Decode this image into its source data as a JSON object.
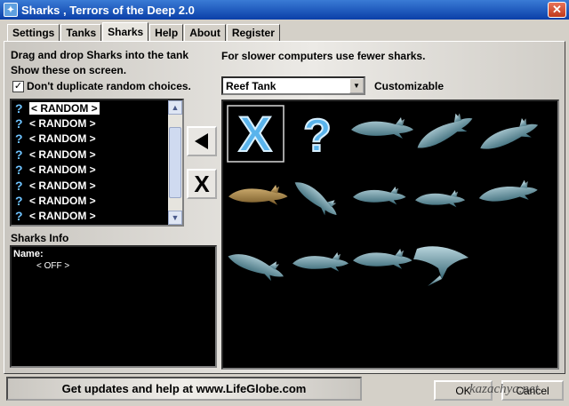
{
  "window": {
    "title": "Sharks , Terrors of the Deep 2.0"
  },
  "tabs": [
    {
      "label": "Settings"
    },
    {
      "label": "Tanks"
    },
    {
      "label": "Sharks"
    },
    {
      "label": "Help"
    },
    {
      "label": "About"
    },
    {
      "label": "Register"
    }
  ],
  "active_tab": "Sharks",
  "left": {
    "instruction1": "Drag and drop Sharks into the tank",
    "instruction2": "Show these on screen.",
    "no_duplicate_label": "Don't duplicate random choices.",
    "no_duplicate_checked": true,
    "list_items": [
      "< RANDOM >",
      "< RANDOM >",
      "< RANDOM >",
      "< RANDOM >",
      "< RANDOM >",
      "< RANDOM >",
      "< RANDOM >",
      "< RANDOM >"
    ],
    "info_heading": "Sharks Info",
    "info_name_label": "Name:",
    "info_name_value": "< OFF >"
  },
  "right": {
    "hint": "For slower computers use fewer sharks.",
    "tank_select_value": "Reef Tank",
    "customizable_label": "Customizable"
  },
  "icons": [
    "app-icon",
    "close-icon",
    "question-icon",
    "arrow-left-icon",
    "remove-x-icon",
    "off-x-icon",
    "random-question-icon",
    "shark-icon",
    "manta-ray-icon",
    "check-icon",
    "chevron-up-icon",
    "chevron-down-icon"
  ],
  "footer": {
    "link_text": "Get updates and help at www.LifeGlobe.com",
    "ok_label": "OK",
    "cancel_label": "Cancel",
    "watermark": "kazachya.net"
  },
  "colors": {
    "title_bar": "#0a3fa8",
    "tank_bg": "#000000",
    "question_accent": "#6ec3ff"
  }
}
